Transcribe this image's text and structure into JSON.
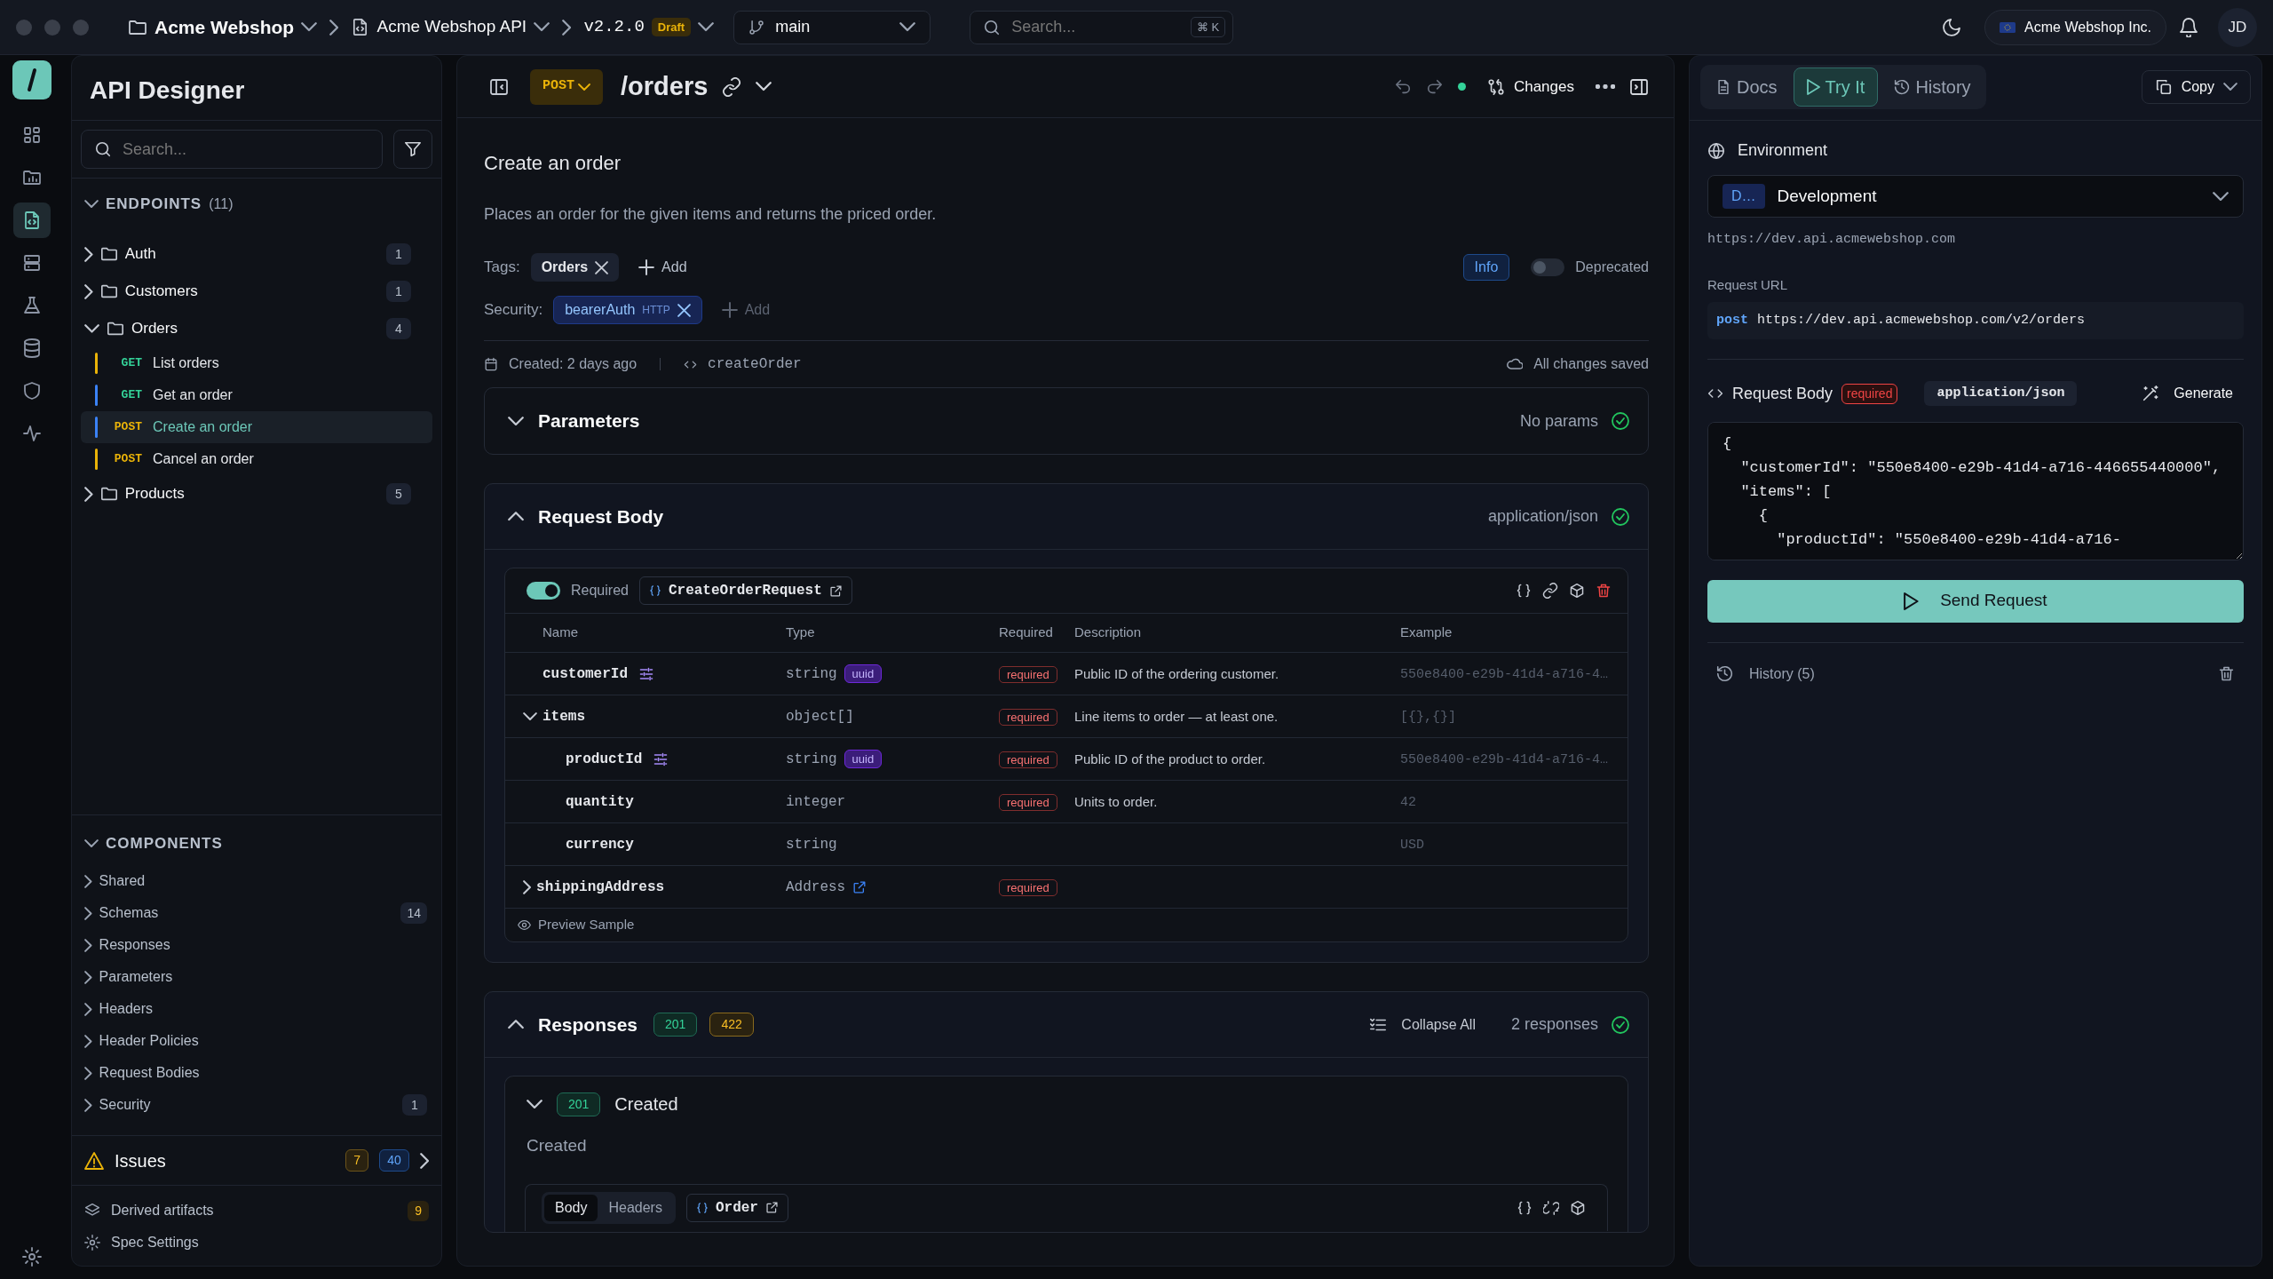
{
  "topbar": {
    "workspace": "Acme Webshop",
    "project": "Acme Webshop API",
    "version": "v2.2.0",
    "version_status": "Draft",
    "branch": "main",
    "search": {
      "placeholder": "Search...",
      "shortcut": "⌘ K"
    },
    "organization": "Acme Webshop Inc.",
    "avatar": "JD"
  },
  "rail": {
    "items": [
      {
        "selected": false
      },
      {
        "selected": false
      },
      {
        "selected": true
      },
      {
        "selected": false
      },
      {
        "selected": false
      },
      {
        "selected": false
      },
      {
        "selected": false
      },
      {
        "selected": false
      }
    ]
  },
  "sidebar": {
    "title": "API Designer",
    "search": {
      "placeholder": "Search..."
    },
    "endpoints": {
      "label": "ENDPOINTS",
      "count": "(11)",
      "expanded": true,
      "groups": [
        {
          "name": "Auth",
          "count": "1",
          "expanded": false
        },
        {
          "name": "Customers",
          "count": "1",
          "expanded": false
        },
        {
          "name": "Orders",
          "count": "4",
          "expanded": true,
          "children": [
            {
              "method": "GET",
              "kind": "get",
              "name": "List orders",
              "color": "#eab308",
              "selected": false
            },
            {
              "method": "GET",
              "kind": "get",
              "name": "Get an order",
              "color": "#3b82f6",
              "selected": false
            },
            {
              "method": "POST",
              "kind": "post",
              "name": "Create an order",
              "color": "#3b82f6",
              "selected": true
            },
            {
              "method": "POST",
              "kind": "post",
              "name": "Cancel an order",
              "color": "#eab308",
              "selected": false
            }
          ]
        },
        {
          "name": "Products",
          "count": "5",
          "expanded": false
        }
      ]
    },
    "components": {
      "label": "COMPONENTS",
      "expanded": true,
      "items": [
        {
          "name": "Shared",
          "expanded": false
        },
        {
          "name": "Schemas",
          "count": "14",
          "expanded": false
        },
        {
          "name": "Responses",
          "expanded": false
        },
        {
          "name": "Parameters",
          "expanded": false
        },
        {
          "name": "Headers",
          "expanded": false
        },
        {
          "name": "Header Policies",
          "expanded": false
        },
        {
          "name": "Request Bodies",
          "expanded": false
        },
        {
          "name": "Security",
          "count": "1",
          "expanded": false
        }
      ]
    },
    "issues": {
      "label": "Issues",
      "warnings": "7",
      "errors": "40"
    },
    "footer": [
      {
        "label": "Derived artifacts",
        "count": "9"
      },
      {
        "label": "Spec Settings"
      }
    ]
  },
  "editor": {
    "method": "POST",
    "path": "/orders",
    "changes": {
      "label": "Changes",
      "pending": true
    },
    "title": "Create an order",
    "description": "Places an order for the given items and returns the priced order.",
    "tags": {
      "label": "Tags:",
      "items": [
        {
          "name": "Orders"
        }
      ],
      "add": {
        "label": "Add",
        "disabled": false
      }
    },
    "info": "Info",
    "deprecated": {
      "label": "Deprecated",
      "on": false
    },
    "security": {
      "label": "Security:",
      "items": [
        {
          "name": "bearerAuth",
          "type": "HTTP"
        }
      ],
      "add": {
        "label": "Add",
        "disabled": true
      }
    },
    "created": "Created: 2 days ago",
    "operation_id": "createOrder",
    "save_status": "All changes saved",
    "parameters": {
      "title": "Parameters",
      "expanded": false,
      "summary": "No params",
      "valid": true
    },
    "request_body": {
      "title": "Request Body",
      "expanded": true,
      "summary": "application/json",
      "valid": true,
      "required": {
        "label": "Required",
        "on": true
      },
      "schema": "CreateOrderRequest",
      "columns": [
        "Name",
        "Type",
        "Required",
        "Description",
        "Example"
      ],
      "rows": [
        {
          "name": "customerId",
          "type": "string",
          "format": "uuid",
          "constraints": true,
          "required": "required",
          "description": "Public ID of the ordering customer.",
          "example": "550e8400-e29b-41d4-a716-4…"
        },
        {
          "name": "items",
          "type": "object[]",
          "required": "required",
          "description": "Line items to order — at least one.",
          "example": "[{},{}]",
          "expanded": true,
          "children": [
            {
              "name": "productId",
              "type": "string",
              "format": "uuid",
              "constraints": true,
              "required": "required",
              "description": "Public ID of the product to order.",
              "example": "550e8400-e29b-41d4-a716-4…"
            },
            {
              "name": "quantity",
              "type": "integer",
              "required": "required",
              "description": "Units to order.",
              "example": "42"
            },
            {
              "name": "currency",
              "type": "string",
              "example": "USD"
            }
          ]
        },
        {
          "name": "shippingAddress",
          "type": "Address",
          "kind": "reference",
          "required": "required",
          "expanded": false
        }
      ],
      "preview": "Preview Sample"
    },
    "responses": {
      "title": "Responses",
      "expanded": true,
      "codes": [
        {
          "code": "201",
          "kind": "success"
        },
        {
          "code": "422",
          "kind": "client_error"
        }
      ],
      "collapse_all": "Collapse All",
      "summary": "2 responses",
      "valid": true,
      "items": [
        {
          "code": "201",
          "kind": "success",
          "title": "Created",
          "expanded": true,
          "description": "Created",
          "tabs": [
            {
              "label": "Body",
              "selected": true
            },
            {
              "label": "Headers",
              "selected": false
            }
          ],
          "schema": "Order"
        }
      ]
    }
  },
  "try_panel": {
    "tabs": [
      {
        "label": "Docs",
        "selected": false
      },
      {
        "label": "Try It",
        "selected": true
      },
      {
        "label": "History",
        "selected": false
      }
    ],
    "copy": "Copy",
    "environment": {
      "label": "Environment",
      "badge": "D…",
      "value": "Development",
      "base_url": "https://dev.api.acmewebshop.com"
    },
    "request_url": {
      "label": "Request URL",
      "method": "post",
      "url": "https://dev.api.acmewebshop.com/v2/orders"
    },
    "body": {
      "label": "Request Body",
      "required": "required",
      "content_type": "application/json",
      "generate": "Generate",
      "code": "{\n  \"customerId\": \"550e8400-e29b-41d4-a716-446655440000\",\n  \"items\": [\n    {\n      \"productId\": \"550e8400-e29b-41d4-a716-"
    },
    "send": "Send Request",
    "history": "History (5)"
  }
}
